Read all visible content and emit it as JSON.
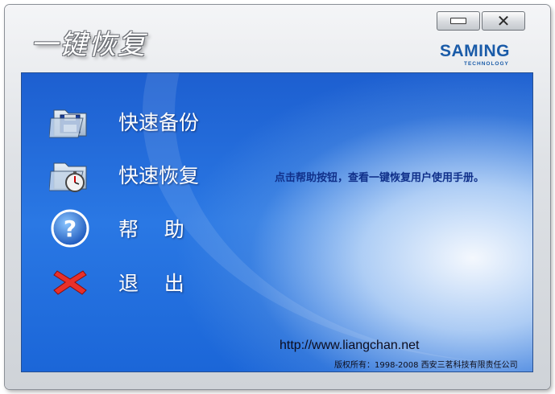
{
  "window": {
    "title": "一键恢复",
    "minimize_icon": "minimize-icon",
    "close_icon": "close-icon"
  },
  "logo": {
    "brand": "SAMING",
    "sub": "TECHNOLOGY"
  },
  "menu": [
    {
      "label": "快速备份",
      "icon": "folder-floppy-icon"
    },
    {
      "label": "快速恢复",
      "icon": "folder-stopwatch-icon"
    },
    {
      "label": "帮    助",
      "icon": "help-question-icon"
    },
    {
      "label": "退    出",
      "icon": "red-x-exit-icon"
    }
  ],
  "hint": "点击帮助按钮，查看一键恢复用户使用手册。",
  "footer": {
    "url": "http://www.liangchan.net",
    "copyright": "版权所有：1998-2008 西安三茗科技有限责任公司"
  },
  "colors": {
    "panel_blue": "#1d5fd0",
    "hint_text": "#10308a",
    "brand_blue": "#1a5ba8"
  }
}
